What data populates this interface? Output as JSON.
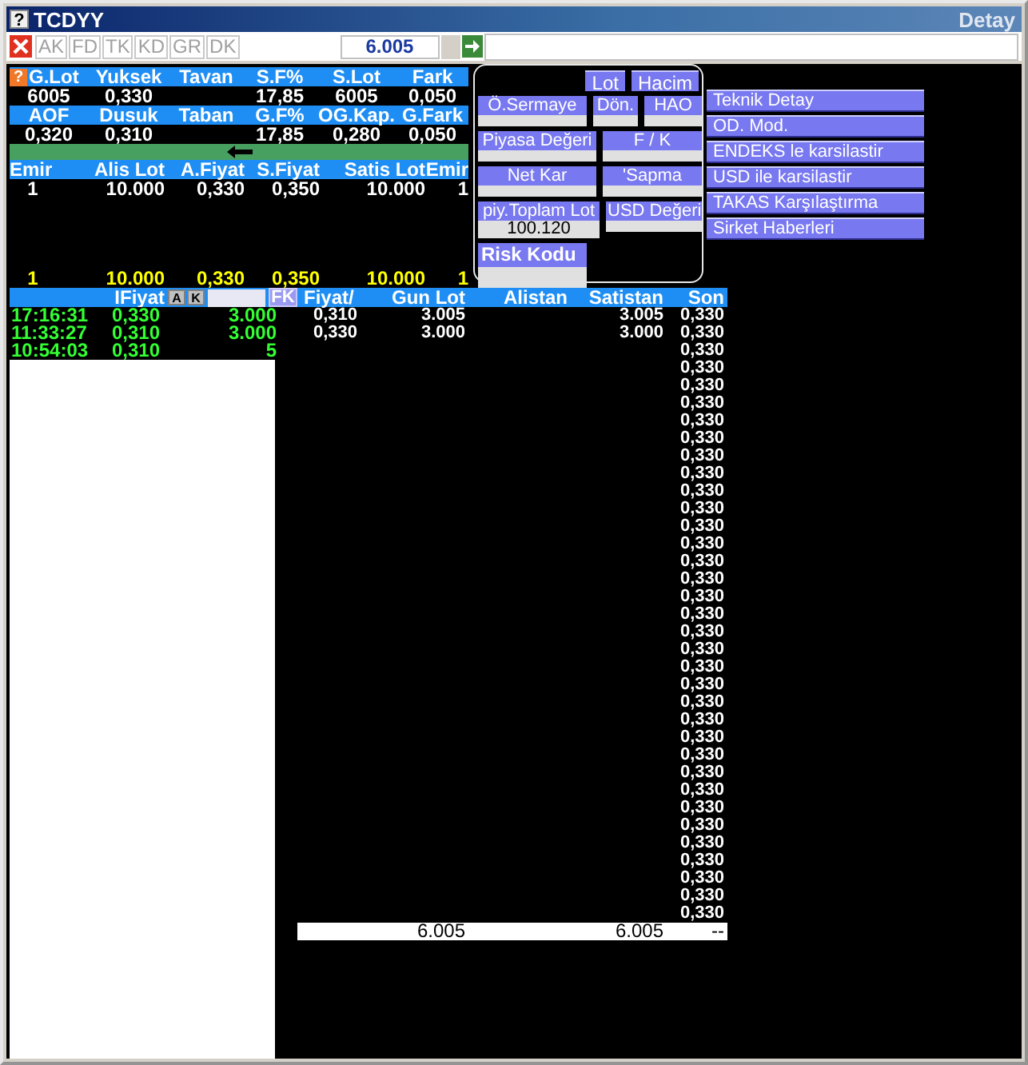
{
  "window": {
    "help_label": "?",
    "title": "TCDYY",
    "right_title": "Detay"
  },
  "toolbar": {
    "buttons": [
      {
        "label": "AK",
        "disabled": true
      },
      {
        "label": "FD",
        "disabled": true
      },
      {
        "label": "TK",
        "disabled": true
      },
      {
        "label": "KD",
        "disabled": true
      },
      {
        "label": "GR",
        "disabled": true
      },
      {
        "label": "DK",
        "disabled": true
      }
    ],
    "price": "6.005"
  },
  "quote": {
    "help_label": "?",
    "blocks": [
      [
        {
          "header": "G.Lot",
          "value": "6005"
        },
        {
          "header": "Yuksek",
          "value": "0,330"
        },
        {
          "header": "Tavan"
        },
        {
          "header": "S.F%",
          "value": "17,85"
        },
        {
          "header": "S.Lot",
          "value": "6005"
        },
        {
          "header": "Fark",
          "value": "0,050"
        }
      ],
      [
        {
          "header": "AOF",
          "value": "0,320"
        },
        {
          "header": "Dusuk",
          "value": "0,310"
        },
        {
          "header": "Taban"
        },
        {
          "header": "G.F%",
          "value": "17,85"
        },
        {
          "header": "OG.Kap.",
          "value": "0,280"
        },
        {
          "header": "G.Fark",
          "value": "0,050"
        }
      ]
    ]
  },
  "depth": {
    "columns": [
      "Emir",
      "Alis Lot",
      "A.Fiyat",
      "S.Fiyat",
      "Satis Lot",
      "Emir"
    ],
    "rows": [
      [
        "1",
        "10.000",
        "0,330",
        "0,350",
        "10.000",
        "1"
      ]
    ],
    "totals": [
      "1",
      "10.000",
      "0,330",
      "0,350",
      "10.000",
      "1"
    ]
  },
  "info": {
    "rows": [
      [
        {
          "kind": "toggle",
          "label": "Lot"
        },
        {
          "kind": "toggle",
          "label": "Hacim"
        }
      ],
      [
        {
          "kind": "field",
          "label": "Ö.Sermaye"
        },
        {
          "kind": "field",
          "label": "Dön."
        },
        {
          "kind": "field",
          "label": "HAO"
        }
      ],
      [
        {
          "kind": "field",
          "label": "Piyasa Değeri"
        },
        {
          "kind": "field",
          "label": "F / K"
        }
      ],
      [
        {
          "kind": "field",
          "label": "Net Kar"
        },
        {
          "kind": "field",
          "label": "'Sapma"
        }
      ],
      [
        {
          "kind": "field",
          "label": "piy.Toplam Lot",
          "value": "100.120"
        },
        {
          "kind": "field",
          "label": "USD Değeri"
        }
      ],
      [
        {
          "kind": "title-field",
          "label": "Risk Kodu"
        }
      ]
    ]
  },
  "menu": [
    "Teknik Detay",
    "OD. Mod.",
    "ENDEKS le karsilastir",
    "USD ile karsilastir",
    "TAKAS Karşılaştırma",
    "Sirket Haberleri"
  ],
  "trades": {
    "header": "IFiyat",
    "buttons": [
      {
        "kind": "small",
        "label": "A"
      },
      {
        "kind": "small",
        "label": "K"
      },
      {
        "kind": "filter"
      },
      {
        "kind": "accent",
        "label": "FK"
      }
    ],
    "rows": [
      [
        "17:16:31",
        "0,330",
        "3.000"
      ],
      [
        "11:33:27",
        "0,310",
        "3.000"
      ],
      [
        "10:54:03",
        "0,310",
        "5"
      ]
    ]
  },
  "prices": {
    "columns": [
      "Fiyat/",
      "Gun Lot",
      "Alistan",
      "Satistan",
      "Son"
    ],
    "rows": [
      {
        "fiyat": "0,310",
        "gun_lot": "3.005",
        "satistan": "3.005",
        "son": "0,330"
      },
      {
        "fiyat": "0,330",
        "gun_lot": "3.000",
        "satistan": "3.000",
        "son": "0,330"
      },
      {
        "son": "0,330"
      },
      {
        "son": "0,330"
      },
      {
        "son": "0,330"
      },
      {
        "son": "0,330"
      },
      {
        "son": "0,330"
      },
      {
        "son": "0,330"
      },
      {
        "son": "0,330"
      },
      {
        "son": "0,330"
      },
      {
        "son": "0,330"
      },
      {
        "son": "0,330"
      },
      {
        "son": "0,330"
      },
      {
        "son": "0,330"
      },
      {
        "son": "0,330"
      },
      {
        "son": "0,330"
      },
      {
        "son": "0,330"
      },
      {
        "son": "0,330"
      },
      {
        "son": "0,330"
      },
      {
        "son": "0,330"
      },
      {
        "son": "0,330"
      },
      {
        "son": "0,330"
      },
      {
        "son": "0,330"
      },
      {
        "son": "0,330"
      },
      {
        "son": "0,330"
      },
      {
        "son": "0,330"
      },
      {
        "son": "0,330"
      },
      {
        "son": "0,330"
      },
      {
        "son": "0,330"
      },
      {
        "son": "0,330"
      },
      {
        "son": "0,330"
      },
      {
        "son": "0,330"
      },
      {
        "son": "0,330"
      },
      {
        "son": "0,330"
      },
      {
        "son": "0,330"
      }
    ],
    "footer": {
      "gun_lot": "6.005",
      "satistan": "6.005",
      "son": "--"
    }
  }
}
